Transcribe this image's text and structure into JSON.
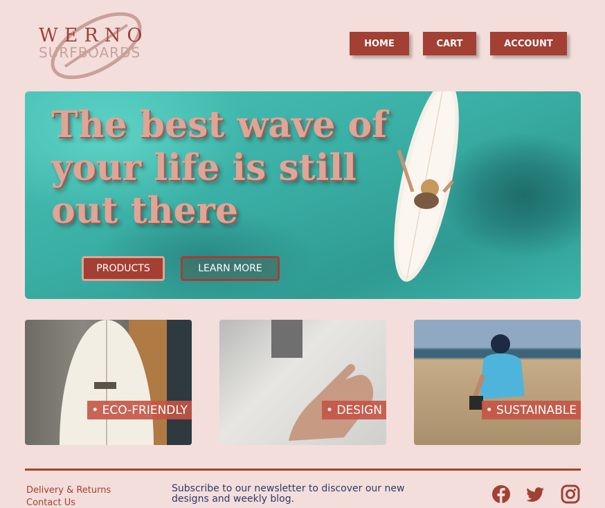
{
  "brand": {
    "name_top": "WERNO",
    "name_bottom": "SURFBOARDS"
  },
  "nav": {
    "items": [
      {
        "label": "HOME"
      },
      {
        "label": "CART"
      },
      {
        "label": "ACCOUNT"
      }
    ]
  },
  "hero": {
    "headline": "The best wave of your life is still out there",
    "buttons": [
      {
        "label": "PRODUCTS"
      },
      {
        "label": "LEARN MORE"
      }
    ]
  },
  "features": [
    {
      "label": "• ECO-FRIENDLY"
    },
    {
      "label": "• DESIGN"
    },
    {
      "label": "• SUSTAINABLE"
    }
  ],
  "footer": {
    "links": [
      {
        "label": "Delivery & Returns"
      },
      {
        "label": "Contact Us"
      }
    ],
    "newsletter": "Subscribe to our newsletter to discover our new designs and weekly blog.",
    "social": [
      "facebook-icon",
      "twitter-icon",
      "instagram-icon"
    ]
  },
  "colors": {
    "brand_red": "#a33f33",
    "background": "#f3dedb",
    "accent_pink": "#dfa596",
    "footer_text": "#2b3a6b"
  }
}
